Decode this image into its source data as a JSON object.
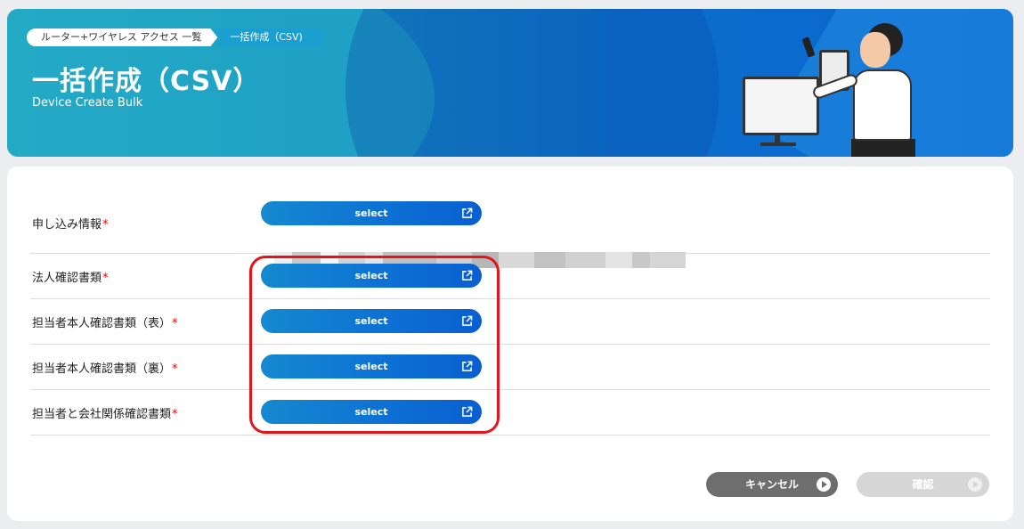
{
  "header": {
    "breadcrumb": [
      "ルーター+ワイヤレス アクセス 一覧",
      "一括作成（CSV)"
    ],
    "title": "一括作成（CSV）",
    "subtitle": "Device Create Bulk"
  },
  "form": {
    "required_mark": "*",
    "select_label": "select",
    "rows": [
      {
        "label": "申し込み情報",
        "required": true
      },
      {
        "label": "法人確認書類",
        "required": true
      },
      {
        "label": "担当者本人確認書類（表）",
        "required": true
      },
      {
        "label": "担当者本人確認書類（裏）",
        "required": true
      },
      {
        "label": "担当者と会社関係確認書類",
        "required": true
      }
    ]
  },
  "actions": {
    "cancel": "キャンセル",
    "confirm": "確認"
  },
  "icons": {
    "select_button": "external-link-icon",
    "action_button": "play-circle-icon"
  },
  "colors": {
    "primary": "#0c6fd4",
    "highlight": "#e5141a",
    "required": "#ee0000",
    "cancel": "#6e6e6e",
    "disabled": "#d6d6d6"
  }
}
